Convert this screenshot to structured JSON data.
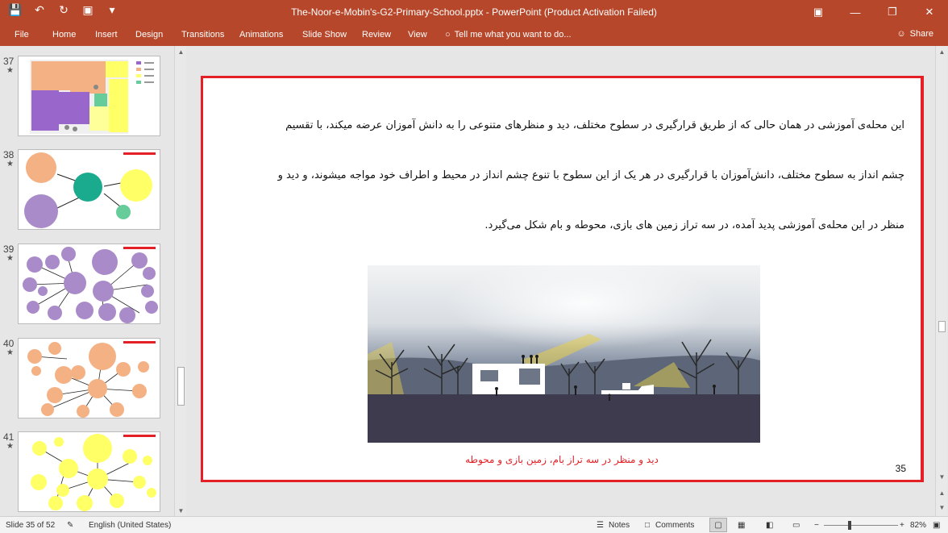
{
  "window": {
    "title": "The-Noor-e-Mobin's-G2-Primary-School.pptx - PowerPoint (Product Activation Failed)"
  },
  "ribbon": {
    "file": "File",
    "tabs": [
      "Home",
      "Insert",
      "Design",
      "Transitions",
      "Animations",
      "Slide Show",
      "Review",
      "View"
    ],
    "tell_me": "Tell me what you want to do...",
    "share": "Share"
  },
  "thumbnails": [
    {
      "number": "37",
      "star": "★"
    },
    {
      "number": "38",
      "star": "★"
    },
    {
      "number": "39",
      "star": "★"
    },
    {
      "number": "40",
      "star": "★"
    },
    {
      "number": "41",
      "star": "★"
    }
  ],
  "slide": {
    "paragraph_line_1": "این محله‌ی آموزشی در همان حالی که از طریق قرارگیری در سطوح مختلف، دید و منظرهای متنوعی را به دانش آموزان عرضه میکند، با تقسیم",
    "paragraph_line_2": "چشم انداز به سطوح مختلف، دانش‌آموزان با قرارگیری در هر یک از این سطوح با تنوع چشم انداز در محیط و اطراف خود مواجه میشوند، و دید و",
    "paragraph_line_3": "منظر در این محله‌ی آموزشی پدید آمده، در سه تراز زمین های بازی، محوطه و بام شکل می‌گیرد.",
    "caption": "دید و منظر در سه تراز بام، زمین بازی و محوطه",
    "number": "35"
  },
  "status": {
    "slide_indicator": "Slide 35 of 52",
    "language": "English (United States)",
    "notes": "Notes",
    "comments": "Comments",
    "zoom": "82%"
  },
  "colors": {
    "ribbon": "#b7472a",
    "slide_border": "#e41f25"
  }
}
